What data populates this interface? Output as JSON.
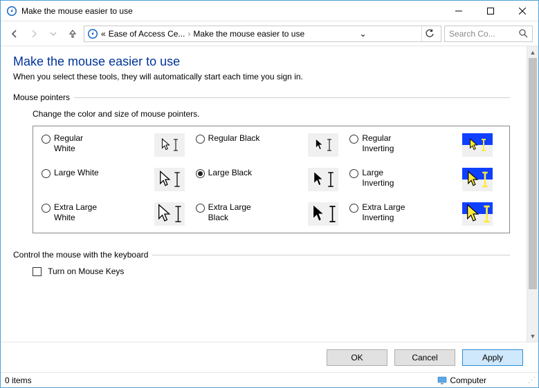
{
  "window": {
    "title": "Make the mouse easier to use"
  },
  "breadcrumb": {
    "prefix": "«",
    "seg1": "Ease of Access Ce...",
    "seg2": "Make the mouse easier to use",
    "dropdown": "⌄"
  },
  "search": {
    "placeholder": "Search Co..."
  },
  "page": {
    "heading": "Make the mouse easier to use",
    "subheading": "When you select these tools, they will automatically start each time you sign in."
  },
  "group_pointers": {
    "title": "Mouse pointers",
    "desc": "Change the color and size of mouse pointers.",
    "options": [
      {
        "label": "Regular White",
        "checked": false
      },
      {
        "label": "Regular Black",
        "checked": false
      },
      {
        "label": "Regular Inverting",
        "checked": false
      },
      {
        "label": "Large White",
        "checked": false
      },
      {
        "label": "Large Black",
        "checked": true
      },
      {
        "label": "Large Inverting",
        "checked": false
      },
      {
        "label": "Extra Large White",
        "checked": false
      },
      {
        "label": "Extra Large Black",
        "checked": false
      },
      {
        "label": "Extra Large Inverting",
        "checked": false
      }
    ]
  },
  "group_keyboard": {
    "title": "Control the mouse with the keyboard",
    "checkbox_label": "Turn on Mouse Keys"
  },
  "buttons": {
    "ok": "OK",
    "cancel": "Cancel",
    "apply": "Apply"
  },
  "status": {
    "items": "0 items",
    "location": "Computer"
  }
}
